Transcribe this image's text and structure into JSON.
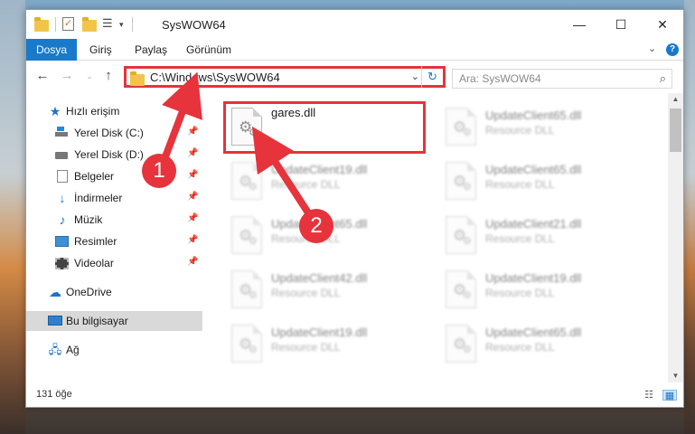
{
  "window": {
    "title": "SysWOW64",
    "controls": {
      "minimize": "—",
      "maximize": "☐",
      "close": "✕"
    }
  },
  "ribbon": {
    "tabs": [
      {
        "label": "Dosya",
        "active": true
      },
      {
        "label": "Giriş",
        "active": false
      },
      {
        "label": "Paylaş",
        "active": false
      },
      {
        "label": "Görünüm",
        "active": false
      }
    ],
    "help": "?"
  },
  "navigation": {
    "address": "C:\\Windows\\SysWOW64",
    "search_placeholder": "Ara: SysWOW64"
  },
  "sidebar": {
    "items": [
      {
        "label": "Hızlı erişim",
        "icon": "star-icon",
        "pinned": false
      },
      {
        "label": "Yerel Disk (C:)",
        "icon": "drive-c-icon",
        "pinned": true
      },
      {
        "label": "Yerel Disk (D:)",
        "icon": "drive-d-icon",
        "pinned": true
      },
      {
        "label": "Belgeler",
        "icon": "documents-icon",
        "pinned": true
      },
      {
        "label": "İndirmeler",
        "icon": "downloads-icon",
        "pinned": true
      },
      {
        "label": "Müzik",
        "icon": "music-icon",
        "pinned": true
      },
      {
        "label": "Resimler",
        "icon": "pictures-icon",
        "pinned": true
      },
      {
        "label": "Videolar",
        "icon": "videos-icon",
        "pinned": true
      },
      {
        "label": "OneDrive",
        "icon": "onedrive-icon",
        "pinned": false
      },
      {
        "label": "Bu bilgisayar",
        "icon": "this-pc-icon",
        "pinned": false,
        "selected": true
      },
      {
        "label": "Ağ",
        "icon": "network-icon",
        "pinned": false
      }
    ]
  },
  "files": {
    "left": [
      {
        "name": "gares.dll",
        "type": "",
        "highlighted": true
      },
      {
        "name": "UpdateClient19.dll",
        "type": "Resource DLL"
      },
      {
        "name": "UpdateClient65.dll",
        "type": "Resource DLL"
      },
      {
        "name": "UpdateClient42.dll",
        "type": "Resource DLL"
      },
      {
        "name": "UpdateClient19.dll",
        "type": "Resource DLL"
      }
    ],
    "right": [
      {
        "name": "UpdateClient65.dll",
        "type": "Resource DLL"
      },
      {
        "name": "UpdateClient65.dll",
        "type": "Resource DLL"
      },
      {
        "name": "UpdateClient21.dll",
        "type": "Resource DLL"
      },
      {
        "name": "UpdateClient19.dll",
        "type": "Resource DLL"
      },
      {
        "name": "UpdateClient65.dll",
        "type": "Resource DLL"
      }
    ]
  },
  "status": {
    "item_count": "131 öğe"
  },
  "annotations": {
    "step1": "1",
    "step2": "2",
    "color": "#e6333c"
  }
}
